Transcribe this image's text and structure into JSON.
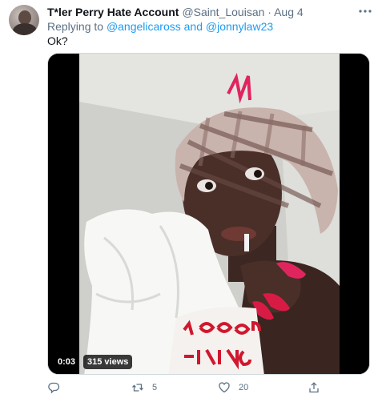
{
  "tweet": {
    "display_name": "T*ler Perry Hate Account",
    "handle": "@Saint_Louisan",
    "separator": "·",
    "date": "Aug 4",
    "reply_prefix": "Replying to",
    "reply_mention_1": "@angelicaross",
    "reply_and": "and",
    "reply_mention_2": "@jonnylaw23",
    "text": "Ok?"
  },
  "media": {
    "type": "video",
    "duration": "0:03",
    "views": "315 views"
  },
  "actions": {
    "reply_icon": "reply-icon",
    "retweet_icon": "retweet-icon",
    "retweet_count": "5",
    "like_icon": "heart-icon",
    "like_count": "20",
    "share_icon": "share-icon"
  },
  "colors": {
    "link": "#1d9bf0",
    "secondary_text": "#5b7083",
    "primary_text": "#0f1419"
  }
}
